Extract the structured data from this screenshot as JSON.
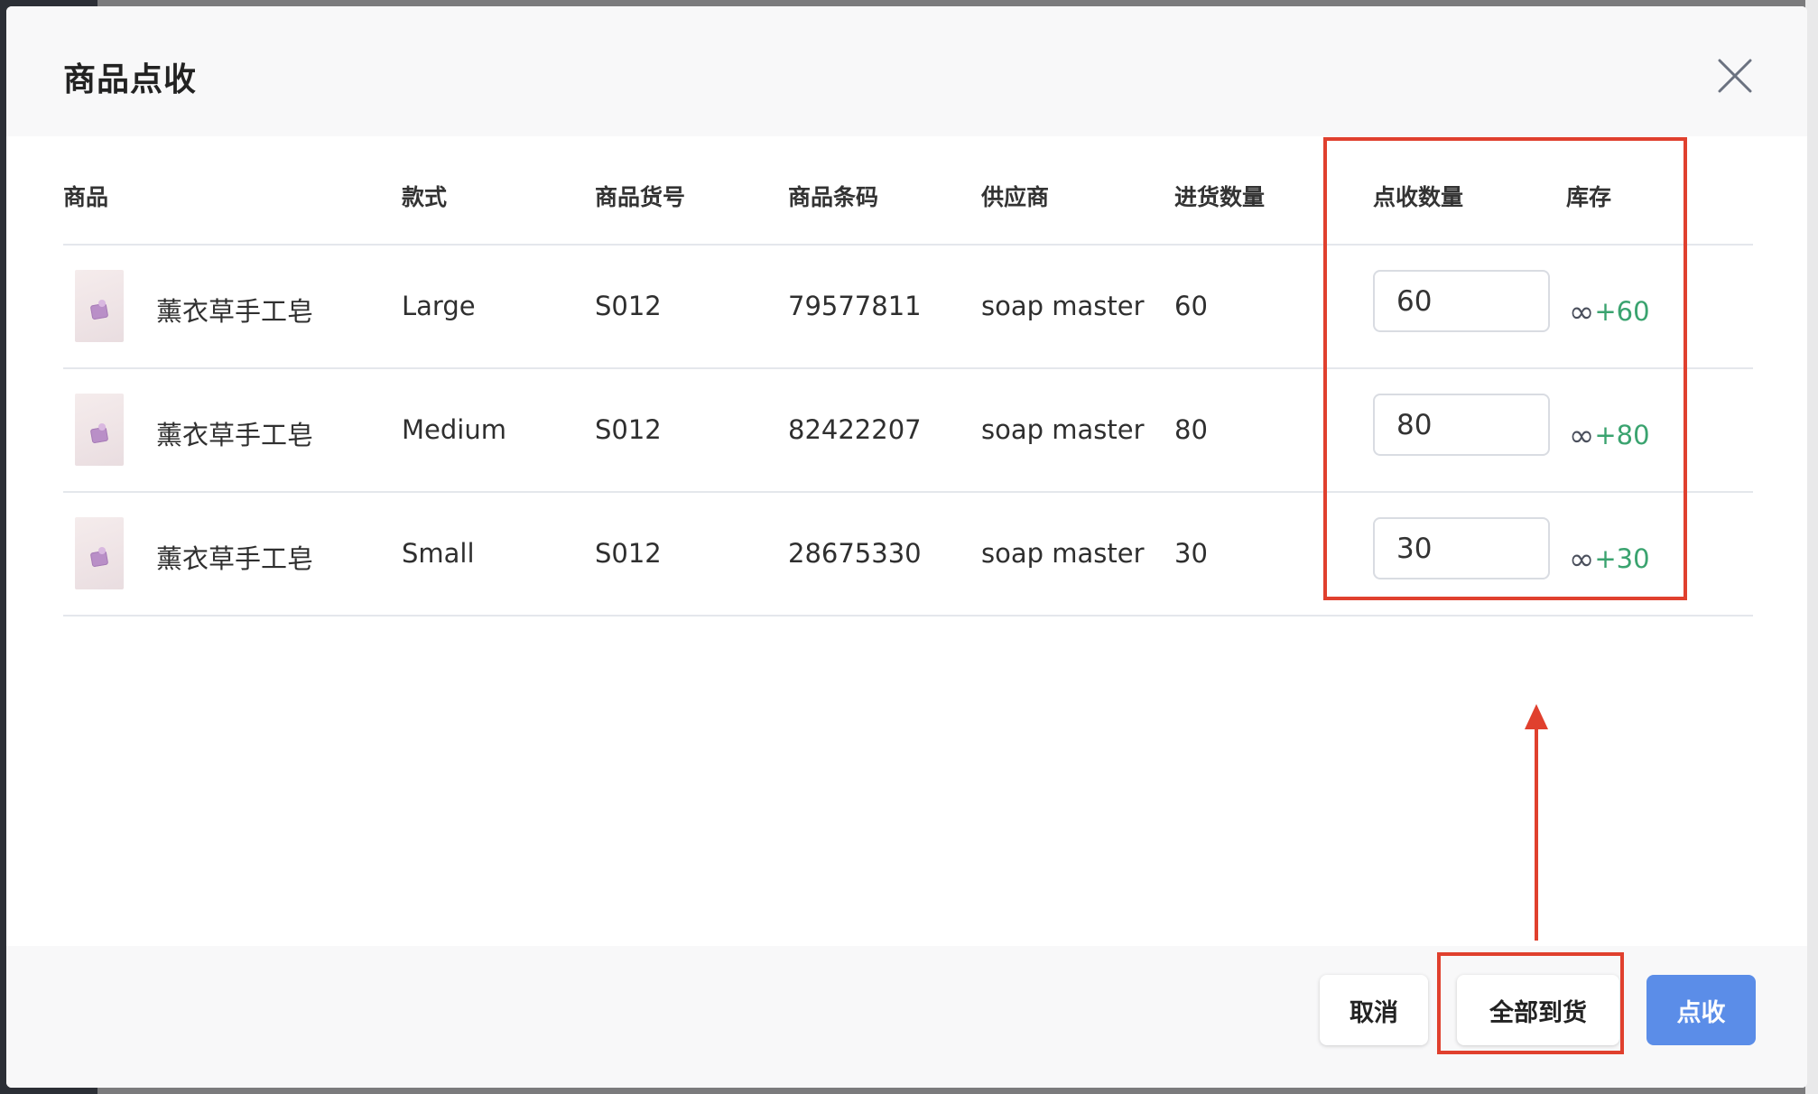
{
  "modal": {
    "title": "商品点收"
  },
  "table": {
    "headers": {
      "product": "商品",
      "style": "款式",
      "sku": "商品货号",
      "barcode": "商品条码",
      "supplier": "供应商",
      "ordered_qty": "进货数量",
      "received_qty": "点收数量",
      "stock": "库存"
    },
    "rows": [
      {
        "product": "薰衣草手工皂",
        "style": "Large",
        "sku": "S012",
        "barcode": "79577811",
        "supplier": "soap master",
        "ordered_qty": "60",
        "received_qty": "60",
        "stock_symbol": "∞",
        "stock_delta": "+60"
      },
      {
        "product": "薰衣草手工皂",
        "style": "Medium",
        "sku": "S012",
        "barcode": "82422207",
        "supplier": "soap master",
        "ordered_qty": "80",
        "received_qty": "80",
        "stock_symbol": "∞",
        "stock_delta": "+80"
      },
      {
        "product": "薰衣草手工皂",
        "style": "Small",
        "sku": "S012",
        "barcode": "28675330",
        "supplier": "soap master",
        "ordered_qty": "30",
        "received_qty": "30",
        "stock_symbol": "∞",
        "stock_delta": "+30"
      }
    ]
  },
  "footer": {
    "cancel_label": "取消",
    "all_arrived_label": "全部到货",
    "confirm_label": "点收"
  },
  "colors": {
    "accent": "#5b8de8",
    "stock_positive": "#3aa36f",
    "annotation": "#e0402e"
  },
  "icons": {
    "close": "close-icon",
    "thumbnail": "product-thumbnail"
  }
}
